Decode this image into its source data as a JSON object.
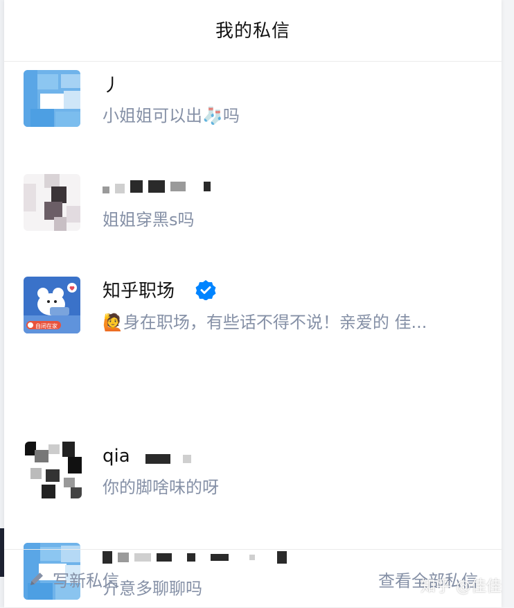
{
  "header": {
    "title": "我的私信"
  },
  "messages": [
    {
      "name": "丿",
      "preview": "小姐姐可以出🧦吗",
      "avatar": "blurred-avatar-blue"
    },
    {
      "name": "",
      "preview": "姐姐穿黑s吗",
      "avatar": "blurred-avatar-dark"
    },
    {
      "name": "知乎职场",
      "preview": "🙋身在职场，有些话不得不说！亲爱的 佳...",
      "avatar": "zhihu-career-avatar",
      "verified": true
    },
    {
      "name": "qia",
      "preview": "你的脚啥味的呀",
      "avatar": "blurred-avatar-mosaic"
    },
    {
      "name": "",
      "preview": "介意多聊聊吗",
      "avatar": "blurred-avatar-blue"
    }
  ],
  "footer": {
    "compose_label": "写新私信",
    "view_all_label": "查看全部私信"
  },
  "watermark": "知乎 @佳佳",
  "colors": {
    "title": "#121212",
    "preview": "#8590a6",
    "verified": "#0084ff",
    "divider": "#ebebeb"
  },
  "avatar_badge_text": "自闭在家"
}
